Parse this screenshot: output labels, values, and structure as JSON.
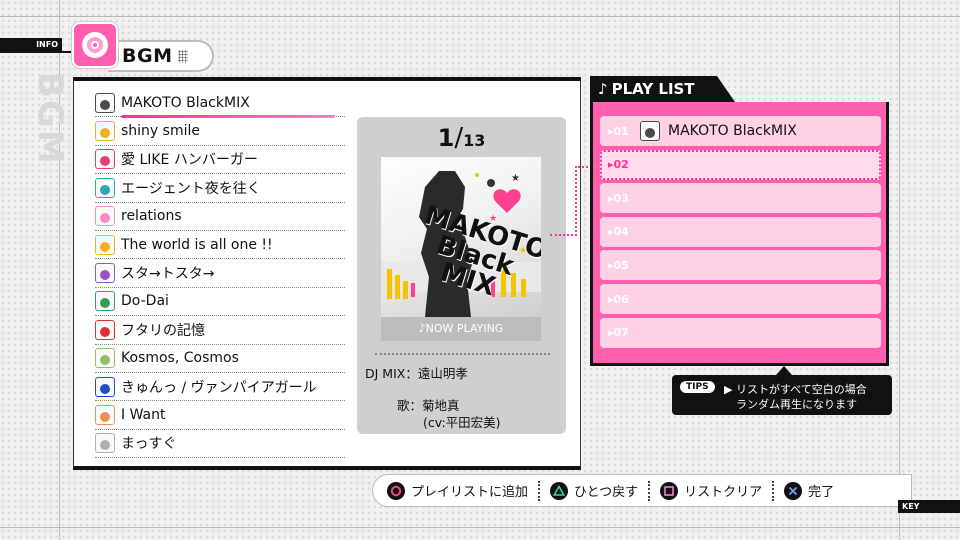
{
  "header": {
    "info_label": "INFO",
    "title": "BGM",
    "vertical_title": "BGM"
  },
  "songs": [
    {
      "title": "MAKOTO BlackMIX",
      "avatar_color": "#4a4a4a",
      "selected": true
    },
    {
      "title": "shiny smile",
      "avatar_color": "#f0b020"
    },
    {
      "title": "愛 LIKE ハンバーガー",
      "avatar_color": "#e0407a"
    },
    {
      "title": "エージェント夜を往く",
      "avatar_color": "#30a8b0"
    },
    {
      "title": "relations",
      "avatar_color": "#f48cc8"
    },
    {
      "title": "The world is all one !!",
      "avatar_color": "#f0b020"
    },
    {
      "title": "スタ→トスタ→",
      "avatar_color": "#9a50c8"
    },
    {
      "title": "Do-Dai",
      "avatar_color": "#30a050"
    },
    {
      "title": "フタリの記憶",
      "avatar_color": "#e03030"
    },
    {
      "title": "Kosmos, Cosmos",
      "avatar_color": "#90c060"
    },
    {
      "title": "きゅんっ / ヴァンパイアガール",
      "avatar_color": "#2050c0"
    },
    {
      "title": "I Want",
      "avatar_color": "#f09050"
    },
    {
      "title": "まっすぐ",
      "avatar_color": "#b0b0b0"
    }
  ],
  "detail": {
    "current": "1",
    "total": "13",
    "jacket_text": "MAKOTO Black MIX",
    "now_playing": "NOW PLAYING",
    "dj_mix": "DJ MIX：遠山明孝",
    "vocal": "歌：菊地真",
    "vocal_cv": "(cv:平田宏美)"
  },
  "playlist": {
    "title": "PLAY LIST",
    "slots": [
      {
        "num": "01",
        "title": "MAKOTO BlackMIX"
      },
      {
        "num": "02",
        "title": ""
      },
      {
        "num": "03",
        "title": ""
      },
      {
        "num": "04",
        "title": ""
      },
      {
        "num": "05",
        "title": ""
      },
      {
        "num": "06",
        "title": ""
      },
      {
        "num": "07",
        "title": ""
      }
    ]
  },
  "tips": {
    "badge": "TIPS",
    "line1": "▶ リストがすべて空白の場合",
    "line2": "ランダム再生になります"
  },
  "buttons": {
    "circle": "プレイリストに追加",
    "triangle": "ひとつ戻す",
    "square": "リストクリア",
    "cross": "完了"
  },
  "key_label": "KEY",
  "colors": {
    "accent": "#ff5fae",
    "accent_dark": "#ff2f94",
    "slot": "#ffd1e7"
  }
}
